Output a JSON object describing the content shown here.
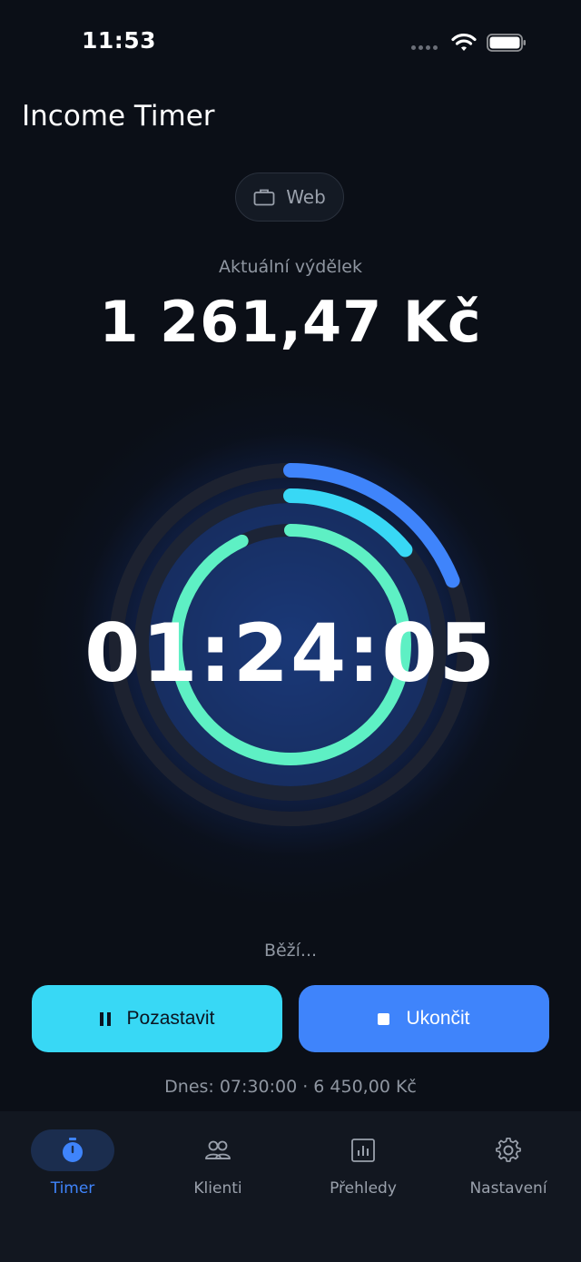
{
  "status_bar": {
    "time": "11:53"
  },
  "app": {
    "title": "Income Timer"
  },
  "project": {
    "name": "Web"
  },
  "earnings": {
    "label": "Aktuální výdělek",
    "value": "1 261,47 Kč"
  },
  "timer": {
    "elapsed": "01:24:05",
    "state": "Běží...",
    "rings": [
      {
        "name": "outer",
        "progress": 0.19,
        "color": "#3f84fb"
      },
      {
        "name": "middle",
        "progress": 0.14,
        "color": "#38d8f5"
      },
      {
        "name": "inner",
        "progress": 0.93,
        "color": "#5ef0c4"
      }
    ]
  },
  "controls": {
    "pause_label": "Pozastavit",
    "stop_label": "Ukončit"
  },
  "summary": {
    "today": "Dnes: 07:30:00 · 6 450,00 Kč"
  },
  "tabs": [
    {
      "label": "Timer",
      "icon": "stopwatch-icon",
      "active": true
    },
    {
      "label": "Klienti",
      "icon": "users-icon",
      "active": false
    },
    {
      "label": "Přehledy",
      "icon": "bar-chart-icon",
      "active": false
    },
    {
      "label": "Nastavení",
      "icon": "gear-icon",
      "active": false
    }
  ],
  "colors": {
    "accent": "#3f84fb",
    "cyan": "#38d8f5",
    "mint": "#5ef0c4",
    "background": "#0b0f17"
  }
}
